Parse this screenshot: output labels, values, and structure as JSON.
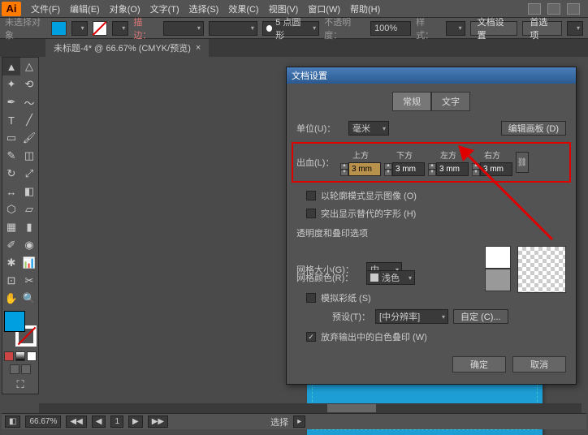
{
  "menu": {
    "file": "文件(F)",
    "edit": "编辑(E)",
    "object": "对象(O)",
    "type": "文字(T)",
    "select": "选择(S)",
    "effect": "效果(C)",
    "view": "视图(V)",
    "window": "窗口(W)",
    "help": "帮助(H)"
  },
  "control": {
    "noselection": "未选择对象",
    "stroke_label": "描边：",
    "stroke_val": "",
    "brush_val": "",
    "style_val": "5 点圆形",
    "opacity_label": "不透明度：",
    "opacity_val": "100%",
    "stylesel_label": "样式：",
    "docsetup_btn": "文档设置",
    "prefs_btn": "首选项"
  },
  "doctab": {
    "name": "未标题-4* @ 66.67% (CMYK/预览)",
    "close": "×"
  },
  "dialog": {
    "title": "文档设置",
    "tab_general": "常规",
    "tab_type": "文字",
    "units_label": "单位(U)：",
    "units_val": "毫米",
    "editartboard_btn": "编辑画板 (D)",
    "bleed_label": "出血(L)：",
    "bleed_headers": {
      "top": "上方",
      "bottom": "下方",
      "left": "左方",
      "right": "右方"
    },
    "bleed_vals": {
      "top": "3 mm",
      "bottom": "3 mm",
      "left": "3 mm",
      "right": "3 mm"
    },
    "chk_outline": "以轮廓模式显示图像 (O)",
    "chk_glyphs": "突出显示替代的字形 (H)",
    "section_transp": "透明度和叠印选项",
    "grid_size_label": "网格大小(G)：",
    "grid_size_val": "中",
    "grid_color_label": "网格颜色(R)：",
    "grid_color_val": "浅色",
    "chk_simpaper": "模拟彩纸 (S)",
    "preset_label": "预设(T)：",
    "preset_val": "[中分辨率]",
    "custom_btn": "自定 (C)...",
    "chk_discard": "放弃输出中的白色叠印 (W)",
    "ok_btn": "确定",
    "cancel_btn": "取消"
  },
  "status": {
    "zoom": "66.67%",
    "nav": "1",
    "sel_label": "选择"
  }
}
